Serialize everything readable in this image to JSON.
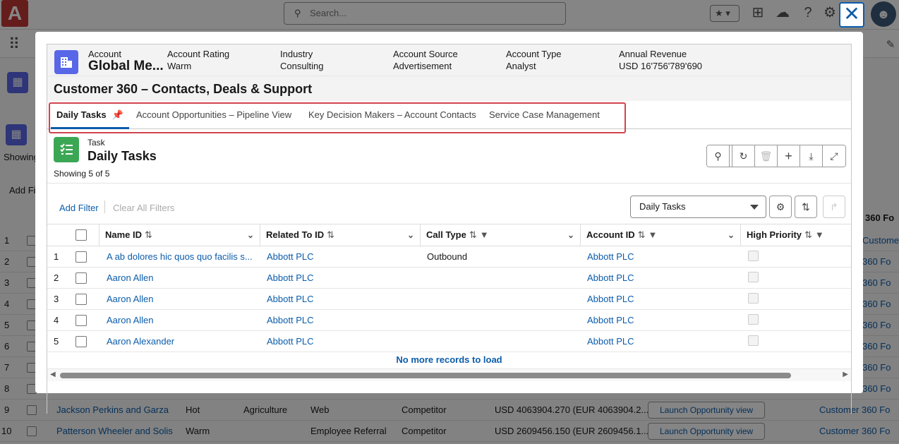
{
  "background": {
    "search_placeholder": "Search...",
    "left_labels": [
      "Showing",
      "Add Fi"
    ],
    "right_header": "360 Fo",
    "rows": [
      {
        "num": "1"
      },
      {
        "num": "2"
      },
      {
        "num": "3"
      },
      {
        "num": "4"
      },
      {
        "num": "5"
      },
      {
        "num": "6"
      },
      {
        "num": "7"
      },
      {
        "num": "8"
      },
      {
        "num": "9",
        "name": "Jackson Perkins and Garza",
        "rating": "Hot",
        "industry": "Agriculture",
        "source": "Web",
        "type": "Competitor",
        "revenue": "USD 4063904.270 (EUR 4063904.2...",
        "button": "Launch Opportunity view",
        "tail": "Customer 360 Fo"
      },
      {
        "num": "10",
        "name": "Patterson Wheeler and Solis",
        "rating": "Warm",
        "industry": "",
        "source": "Employee Referral",
        "type": "Competitor",
        "revenue": "USD 2609456.150 (EUR 2609456.1...",
        "button": "Launch Opportunity view",
        "tail": "Customer 360 Fo"
      }
    ],
    "right_col": [
      "Customer 360 Fo",
      "360 Fo",
      "360 Fo",
      "360 Fo",
      "360 Fo",
      "360 Fo",
      "360 Fo",
      "360 Fo"
    ]
  },
  "modal": {
    "close_label": "✕",
    "header": {
      "fields": [
        {
          "label": "Account",
          "value": "Global Me..."
        },
        {
          "label": "Account Rating",
          "value": "Warm"
        },
        {
          "label": "Industry",
          "value": "Consulting"
        },
        {
          "label": "Account Source",
          "value": "Advertisement"
        },
        {
          "label": "Account Type",
          "value": "Analyst"
        },
        {
          "label": "Annual Revenue",
          "value": "USD 16'756'789'690"
        }
      ]
    },
    "title": "Customer 360 – Contacts, Deals & Support",
    "tabs": [
      {
        "label": "Daily Tasks"
      },
      {
        "label": "Account Opportunities – Pipeline View"
      },
      {
        "label": "Key Decision Makers – Account Contacts"
      },
      {
        "label": "Service Case Management"
      }
    ],
    "list": {
      "object_label": "Task",
      "title": "Daily Tasks",
      "showing": "Showing 5 of 5",
      "add_filter": "Add Filter",
      "clear_filters": "Clear All Filters",
      "view_selected": "Daily Tasks",
      "columns": [
        "Name ID",
        "Related To ID",
        "Call Type",
        "Account ID",
        "High Priority"
      ],
      "rows": [
        {
          "num": "1",
          "name": "A ab dolores hic quos quo facilis s...",
          "related": "Abbott PLC",
          "call_type": "Outbound",
          "account": "Abbott PLC"
        },
        {
          "num": "2",
          "name": "Aaron Allen",
          "related": "Abbott PLC",
          "call_type": "",
          "account": "Abbott PLC"
        },
        {
          "num": "3",
          "name": "Aaron Allen",
          "related": "Abbott PLC",
          "call_type": "",
          "account": "Abbott PLC"
        },
        {
          "num": "4",
          "name": "Aaron Allen",
          "related": "Abbott PLC",
          "call_type": "",
          "account": "Abbott PLC"
        },
        {
          "num": "5",
          "name": "Aaron Alexander",
          "related": "Abbott PLC",
          "call_type": "",
          "account": "Abbott PLC"
        }
      ],
      "footer": "No more records to load"
    }
  },
  "colors": {
    "brand": "#0b5cab",
    "account_icon": "#5867e8",
    "task_icon": "#3ba755",
    "highlight": "#d0444e"
  }
}
